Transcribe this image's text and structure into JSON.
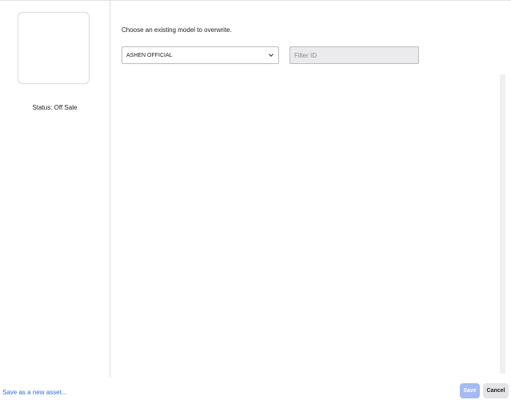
{
  "left_panel": {
    "status": "Status: Off Sale"
  },
  "main": {
    "instruction": "Choose an existing model to overwrite.",
    "model_select": {
      "selected": "ASHEN OFFICIAL"
    },
    "filter": {
      "placeholder": "Filter ID",
      "value": ""
    }
  },
  "footer": {
    "save_new_link": "Save as a new asset...",
    "save_label": "Save",
    "cancel_label": "Cancel"
  },
  "colors": {
    "link": "#2f6fe0",
    "save_button_disabled": "#a6b9f5",
    "cancel_button": "#e4e4e6",
    "filter_background": "#ebebee"
  },
  "icons": {
    "dropdown": "chevron-down-icon"
  }
}
